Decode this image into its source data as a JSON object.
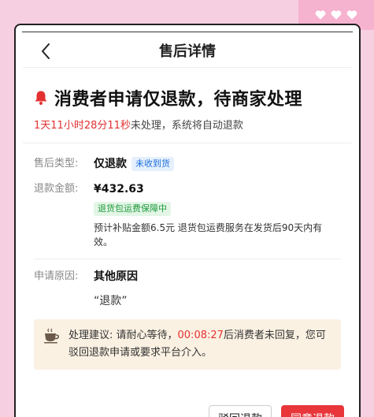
{
  "header": {
    "title": "售后详情"
  },
  "status": {
    "title": "消费者申请仅退款，待商家处理",
    "countdown": "1天11小时28分11秒",
    "suffix": "未处理，系统将自动退款"
  },
  "info": {
    "type": {
      "label": "售后类型:",
      "value": "仅退款",
      "tag": "未收到货"
    },
    "amount": {
      "label": "退款金额:",
      "value": "¥432.63",
      "tag": "退货包运费保障中",
      "note": "预计补贴金额6.5元 退货包运费服务在发货后90天内有效。"
    },
    "reason": {
      "label": "申请原因:",
      "value": "其他原因",
      "quote": "“退款”"
    }
  },
  "advice": {
    "prefix": "处理建议: 请耐心等待，",
    "countdown": "00:08:27",
    "suffix": "后消费者未回复，您可驳回退款申请或要求平台介入。"
  },
  "buttons": {
    "reject": "驳回退款",
    "agree": "同意退款"
  },
  "colors": {
    "accent_red": "#e33131",
    "tag_blue": "#1c6fdc",
    "tag_green": "#1e9a3b",
    "page_pink": "#f6cfe0"
  }
}
